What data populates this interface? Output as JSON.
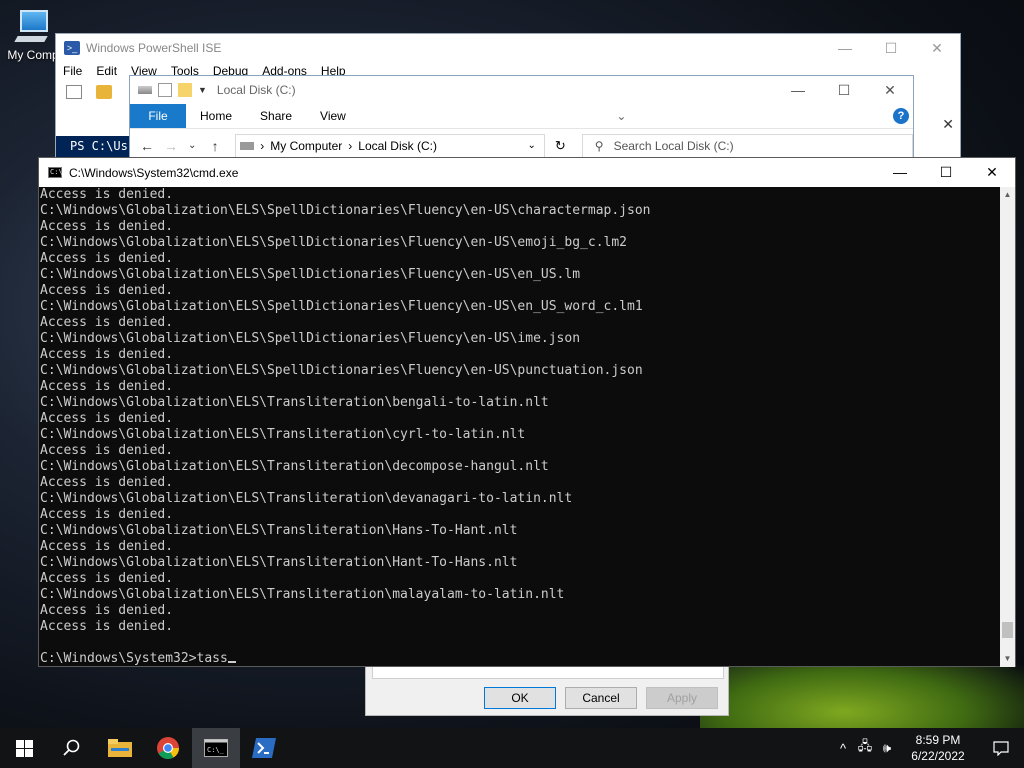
{
  "desktop": {
    "icons": [
      {
        "label": "My Comp",
        "icon": "computer-icon"
      }
    ]
  },
  "ise": {
    "title": "Windows PowerShell ISE",
    "menu": [
      "File",
      "Edit",
      "View",
      "Tools",
      "Debug",
      "Add-ons",
      "Help"
    ],
    "console_prompt": "PS C:\\Us",
    "caption": {
      "minimize": "—",
      "maximize": "☐",
      "close": "✕"
    }
  },
  "explorer": {
    "title": "Local Disk (C:)",
    "ribbon_tabs": [
      "File",
      "Home",
      "Share",
      "View"
    ],
    "help_label": "?",
    "breadcrumb": [
      "My Computer",
      "Local Disk (C:)"
    ],
    "search_placeholder": "Search Local Disk (C:)",
    "caption": {
      "minimize": "—",
      "maximize": "☐",
      "close": "✕"
    }
  },
  "properties_dialog": {
    "ok_label": "OK",
    "cancel_label": "Cancel",
    "apply_label": "Apply"
  },
  "cmd": {
    "title": "C:\\Windows\\System32\\cmd.exe",
    "caption": {
      "minimize": "—",
      "maximize": "☐",
      "close": "✕"
    },
    "lines": [
      "Access is denied.",
      "C:\\Windows\\Globalization\\ELS\\SpellDictionaries\\Fluency\\en-US\\charactermap.json",
      "Access is denied.",
      "C:\\Windows\\Globalization\\ELS\\SpellDictionaries\\Fluency\\en-US\\emoji_bg_c.lm2",
      "Access is denied.",
      "C:\\Windows\\Globalization\\ELS\\SpellDictionaries\\Fluency\\en-US\\en_US.lm",
      "Access is denied.",
      "C:\\Windows\\Globalization\\ELS\\SpellDictionaries\\Fluency\\en-US\\en_US_word_c.lm1",
      "Access is denied.",
      "C:\\Windows\\Globalization\\ELS\\SpellDictionaries\\Fluency\\en-US\\ime.json",
      "Access is denied.",
      "C:\\Windows\\Globalization\\ELS\\SpellDictionaries\\Fluency\\en-US\\punctuation.json",
      "Access is denied.",
      "C:\\Windows\\Globalization\\ELS\\Transliteration\\bengali-to-latin.nlt",
      "Access is denied.",
      "C:\\Windows\\Globalization\\ELS\\Transliteration\\cyrl-to-latin.nlt",
      "Access is denied.",
      "C:\\Windows\\Globalization\\ELS\\Transliteration\\decompose-hangul.nlt",
      "Access is denied.",
      "C:\\Windows\\Globalization\\ELS\\Transliteration\\devanagari-to-latin.nlt",
      "Access is denied.",
      "C:\\Windows\\Globalization\\ELS\\Transliteration\\Hans-To-Hant.nlt",
      "Access is denied.",
      "C:\\Windows\\Globalization\\ELS\\Transliteration\\Hant-To-Hans.nlt",
      "Access is denied.",
      "C:\\Windows\\Globalization\\ELS\\Transliteration\\malayalam-to-latin.nlt",
      "Access is denied.",
      "Access is denied.",
      "",
      "C:\\Windows\\System32>tass"
    ],
    "scroll_position": 0.97
  },
  "taskbar": {
    "pinned": [
      "start-icon",
      "search-icon",
      "file-explorer-icon",
      "chrome-icon",
      "cmd-icon",
      "powershell-ise-icon"
    ],
    "active": "cmd-icon",
    "time": "8:59 PM",
    "date": "6/22/2022"
  },
  "colors": {
    "console_bg": "#0c0c0c",
    "console_fg": "#cccccc",
    "accent": "#1979ca",
    "taskbar": "#111315"
  }
}
